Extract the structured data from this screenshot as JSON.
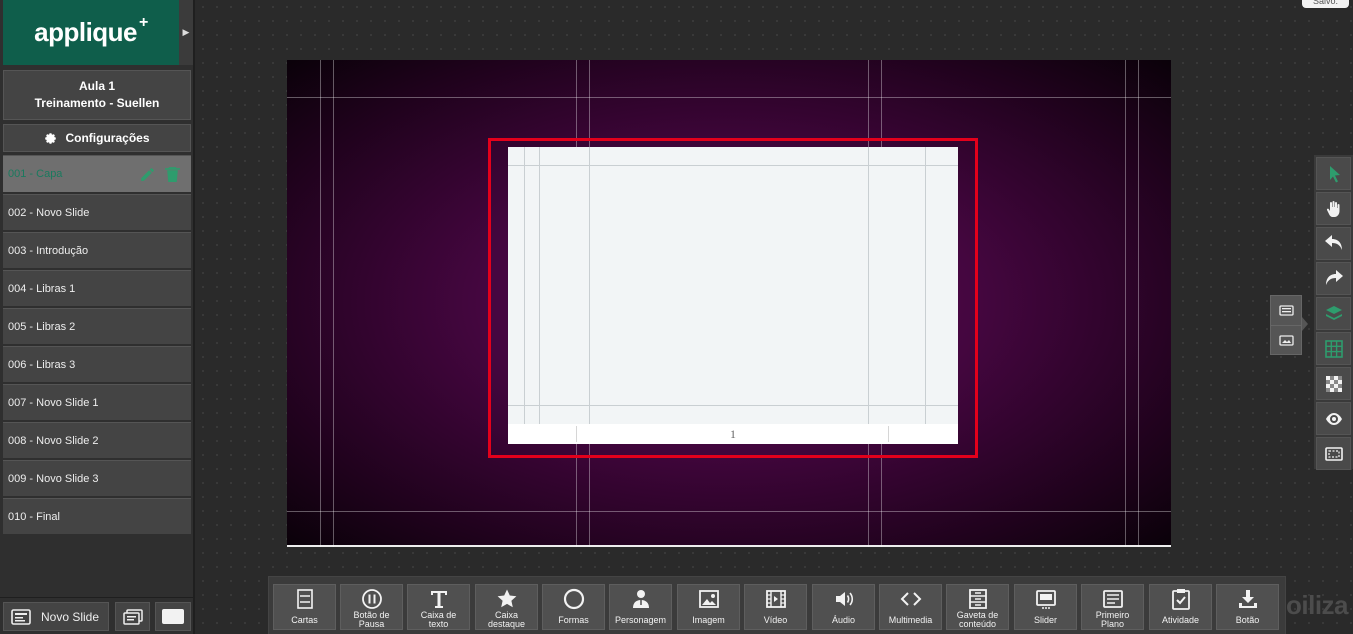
{
  "brand": {
    "name": "applique",
    "mark": "+"
  },
  "course": {
    "line1": "Aula 1",
    "line2": "Treinamento - Suellen"
  },
  "settings_label": "Configurações",
  "slides": [
    {
      "label": "001 - Capa",
      "active": true
    },
    {
      "label": "002 - Novo Slide"
    },
    {
      "label": "003 - Introdução"
    },
    {
      "label": "004 - Libras 1"
    },
    {
      "label": "005 - Libras 2"
    },
    {
      "label": "006 - Libras 3"
    },
    {
      "label": "007 - Novo Slide 1"
    },
    {
      "label": "008 - Novo Slide 2"
    },
    {
      "label": "009 - Novo Slide 3"
    },
    {
      "label": "010 - Final"
    }
  ],
  "new_slide_label": "Novo Slide",
  "canvas": {
    "page_number": "1"
  },
  "toolbar": [
    {
      "icon": "cards-icon",
      "label": "Cartas"
    },
    {
      "icon": "pause-icon",
      "label": "Botão de\nPausa"
    },
    {
      "icon": "text-icon",
      "label": "Caixa de\ntexto"
    },
    {
      "icon": "star-icon",
      "label": "Caixa\ndestaque"
    },
    {
      "icon": "circle-icon",
      "label": "Formas"
    },
    {
      "icon": "character-icon",
      "label": "Personagem"
    },
    {
      "icon": "image-icon",
      "label": "Imagem"
    },
    {
      "icon": "video-icon",
      "label": "Vídeo"
    },
    {
      "icon": "audio-icon",
      "label": "Áudio"
    },
    {
      "icon": "code-icon",
      "label": "Multimedia"
    },
    {
      "icon": "drawer-icon",
      "label": "Gaveta de\nconteúdo"
    },
    {
      "icon": "slider-icon",
      "label": "Slider"
    },
    {
      "icon": "foreground-icon",
      "label": "Primeiro\nPlano"
    },
    {
      "icon": "clipboard-check-icon",
      "label": "Atividade"
    },
    {
      "icon": "download-icon",
      "label": "Botão"
    }
  ],
  "right_tools": [
    "pointer-icon",
    "hand-icon",
    "undo-icon",
    "redo-icon",
    "layers-icon",
    "grid-icon",
    "checker-icon",
    "eye-icon",
    "safe-area-icon"
  ],
  "watermark": "oiliza",
  "save_label": "Salvo.",
  "colors": {
    "brand": "#0f5e4b",
    "active_text": "#1a7a5e",
    "selection": "#e3001b",
    "icon_green": "#2e9c6d"
  }
}
